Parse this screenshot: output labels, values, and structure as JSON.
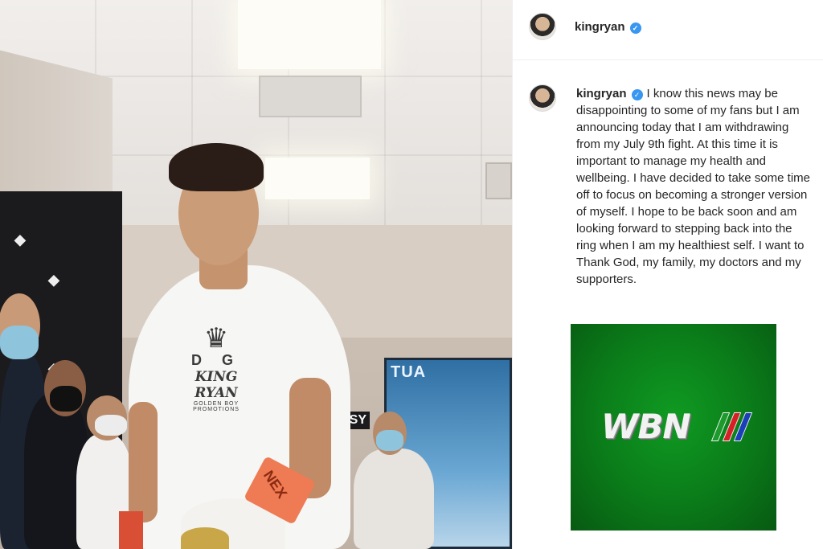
{
  "post": {
    "header": {
      "username": "kingryan",
      "verified_icon": "verified-badge-icon"
    },
    "caption": {
      "username": "kingryan",
      "text": "I know this news may be disappointing to some of my fans but I am announcing today that I am withdrawing from my July 9th fight. At this time it is important to manage my health and wellbeing. I have decided to take some time off to focus on becoming a stronger version of myself. I hope to be back soon and am looking forward to stepping back into the ring when I am my healthiest self. I want to Thank God, my family, my doctors and my supporters."
    },
    "attached_image": {
      "logo_text": "WBN",
      "background_color": "#0b7e1a",
      "stripe_colors": [
        "#1c9a2c",
        "#d61f26",
        "#1b3fb8"
      ]
    }
  },
  "photo": {
    "shirt_logo_top": "D G",
    "shirt_logo_main": "KING RYAN",
    "shirt_logo_small": "GOLDEN BOY PROMOTIONS",
    "glove_strap_text": "NEX",
    "screen_text": "TUA",
    "banner_text": "SSY"
  },
  "colors": {
    "accent_verified": "#3897f0",
    "text": "#262626",
    "divider": "#efefef"
  }
}
